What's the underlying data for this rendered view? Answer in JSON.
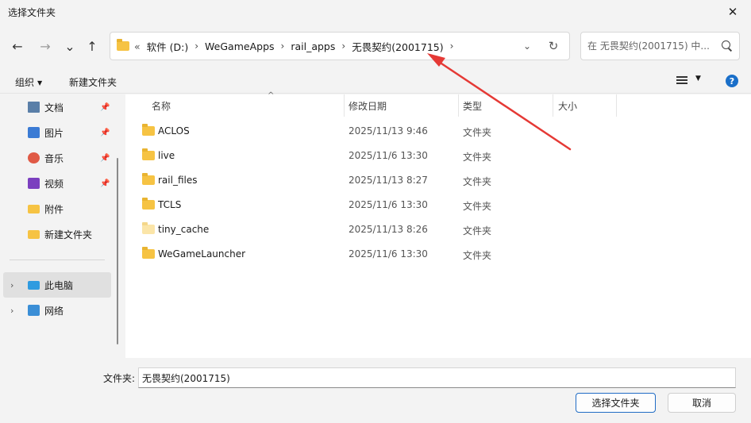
{
  "window": {
    "title": "选择文件夹",
    "close_glyph": "✕"
  },
  "nav": {
    "back": "←",
    "forward": "→",
    "recent": "⌄",
    "up": "↑"
  },
  "address": {
    "overflow": "«",
    "crumbs": [
      "软件 (D:)",
      "WeGameApps",
      "rail_apps",
      "无畏契约(2001715)"
    ],
    "separator": "›",
    "dropdown": "⌄",
    "refresh": "↻"
  },
  "search": {
    "placeholder": "在 无畏契约(2001715) 中..."
  },
  "toolbar": {
    "organize": "组织",
    "new_folder": "新建文件夹",
    "help": "?"
  },
  "sidebar": {
    "items": [
      {
        "label": "文档",
        "icon": "document-icon",
        "pinned": true
      },
      {
        "label": "图片",
        "icon": "pictures-icon",
        "pinned": true
      },
      {
        "label": "音乐",
        "icon": "music-icon",
        "pinned": true
      },
      {
        "label": "视频",
        "icon": "video-icon",
        "pinned": true
      },
      {
        "label": "附件",
        "icon": "folder-icon",
        "pinned": false
      },
      {
        "label": "新建文件夹",
        "icon": "folder-icon",
        "pinned": false
      }
    ],
    "this_pc": "此电脑",
    "network": "网络",
    "pin_glyph": "📌",
    "chevron": "›"
  },
  "columns": {
    "name": "名称",
    "modified": "修改日期",
    "type": "类型",
    "size": "大小",
    "sort_glyph": "^"
  },
  "files": [
    {
      "name": "ACLOS",
      "modified": "2025/11/13 9:46",
      "type": "文件夹"
    },
    {
      "name": "live",
      "modified": "2025/11/6 13:30",
      "type": "文件夹"
    },
    {
      "name": "rail_files",
      "modified": "2025/11/13 8:27",
      "type": "文件夹"
    },
    {
      "name": "TCLS",
      "modified": "2025/11/6 13:30",
      "type": "文件夹"
    },
    {
      "name": "tiny_cache",
      "modified": "2025/11/13 8:26",
      "type": "文件夹"
    },
    {
      "name": "WeGameLauncher",
      "modified": "2025/11/6 13:30",
      "type": "文件夹"
    }
  ],
  "footer": {
    "folder_label": "文件夹:",
    "folder_value": "无畏契约(2001715)",
    "select_button": "选择文件夹",
    "cancel_button": "取消"
  },
  "colors": {
    "accent": "#1a6fc9",
    "folder": "#f6c343",
    "annotation_arrow": "#e53935"
  }
}
